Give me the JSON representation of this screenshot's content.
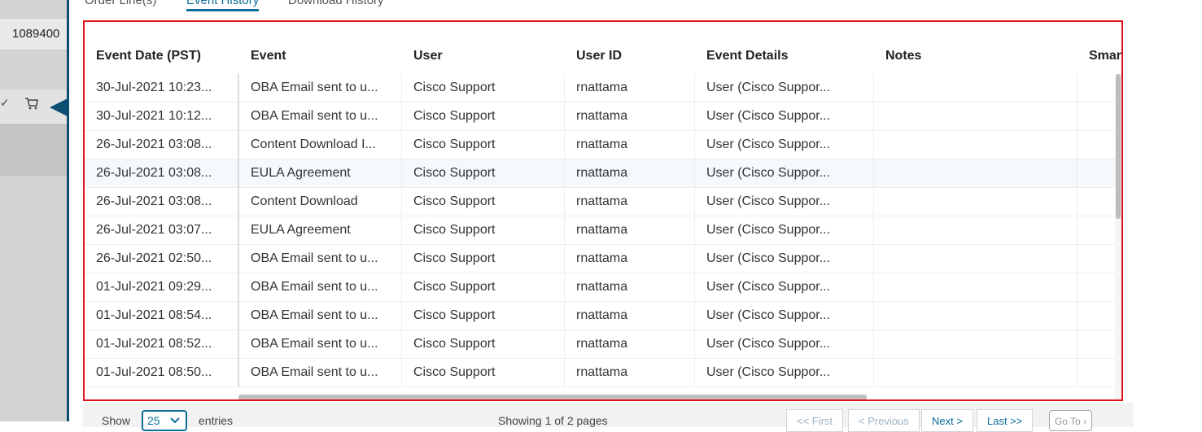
{
  "background": {
    "id_value": "1089400"
  },
  "tabs": [
    {
      "label": "Order Line(s)"
    },
    {
      "label": "Event History"
    },
    {
      "label": "Download History"
    }
  ],
  "table": {
    "columns": [
      "Event Date (PST)",
      "Event",
      "User",
      "User ID",
      "Event Details",
      "Notes",
      "Smar"
    ],
    "rows": [
      [
        "30-Jul-2021 10:23...",
        "OBA Email sent to u...",
        "Cisco Support",
        "rnattama",
        "User (Cisco Suppor...",
        "",
        ""
      ],
      [
        "30-Jul-2021 10:12...",
        "OBA Email sent to u...",
        "Cisco Support",
        "rnattama",
        "User (Cisco Suppor...",
        "",
        ""
      ],
      [
        "26-Jul-2021 03:08...",
        "Content Download I...",
        "Cisco Support",
        "rnattama",
        "User (Cisco Suppor...",
        "",
        ""
      ],
      [
        "26-Jul-2021 03:08...",
        "EULA Agreement",
        "Cisco Support",
        "rnattama",
        "User (Cisco Suppor...",
        "",
        ""
      ],
      [
        "26-Jul-2021 03:08...",
        "Content Download",
        "Cisco Support",
        "rnattama",
        "User (Cisco Suppor...",
        "",
        ""
      ],
      [
        "26-Jul-2021 03:07...",
        "EULA Agreement",
        "Cisco Support",
        "rnattama",
        "User (Cisco Suppor...",
        "",
        ""
      ],
      [
        "26-Jul-2021 02:50...",
        "OBA Email sent to u...",
        "Cisco Support",
        "rnattama",
        "User (Cisco Suppor...",
        "",
        ""
      ],
      [
        "01-Jul-2021 09:29...",
        "OBA Email sent to u...",
        "Cisco Support",
        "rnattama",
        "User (Cisco Suppor...",
        "",
        ""
      ],
      [
        "01-Jul-2021 08:54...",
        "OBA Email sent to u...",
        "Cisco Support",
        "rnattama",
        "User (Cisco Suppor...",
        "",
        ""
      ],
      [
        "01-Jul-2021 08:52...",
        "OBA Email sent to u...",
        "Cisco Support",
        "rnattama",
        "User (Cisco Suppor...",
        "",
        ""
      ],
      [
        "01-Jul-2021 08:50...",
        "OBA Email sent to u...",
        "Cisco Support",
        "rnattama",
        "User (Cisco Suppor...",
        "",
        ""
      ]
    ],
    "highlighted_row_index": 3
  },
  "footer": {
    "show_label": "Show",
    "page_size": "25",
    "entries_label": "entries",
    "page_status": "Showing 1 of 2 pages",
    "first": "<< First",
    "previous": "< Previous",
    "next": "Next >",
    "last": "Last >>",
    "goto": "Go To"
  },
  "colors": {
    "accent": "#0d6e9a",
    "modal_border": "#0d4f73",
    "selection_outline": "#e0151b"
  }
}
